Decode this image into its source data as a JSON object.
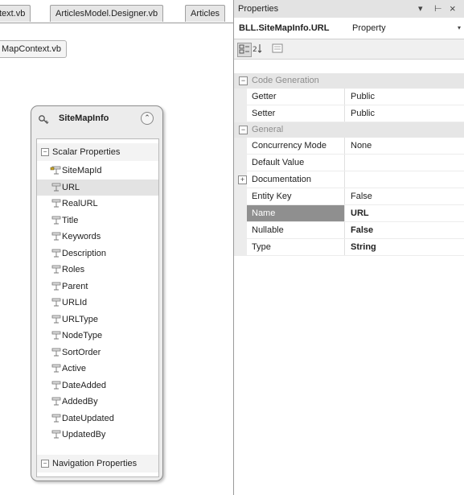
{
  "designer": {
    "tabs": [
      "text.vb",
      "ArticlesModel.Designer.vb",
      "Articles"
    ],
    "subfile_tab": "MapContext.vb",
    "entity": {
      "title": "SiteMapInfo",
      "sections": {
        "scalar": "Scalar Properties",
        "navigation": "Navigation Properties"
      },
      "properties": [
        {
          "name": "SiteMapId",
          "key": true
        },
        {
          "name": "URL",
          "selected": true
        },
        {
          "name": "RealURL"
        },
        {
          "name": "Title"
        },
        {
          "name": "Keywords"
        },
        {
          "name": "Description"
        },
        {
          "name": "Roles"
        },
        {
          "name": "Parent"
        },
        {
          "name": "URLId"
        },
        {
          "name": "URLType"
        },
        {
          "name": "NodeType"
        },
        {
          "name": "SortOrder"
        },
        {
          "name": "Active"
        },
        {
          "name": "DateAdded"
        },
        {
          "name": "AddedBy"
        },
        {
          "name": "DateUpdated"
        },
        {
          "name": "UpdatedBy"
        }
      ]
    }
  },
  "properties_pane": {
    "title": "Properties",
    "window_buttons": {
      "pin": "- ⊕",
      "close": "×"
    },
    "object_name": "BLL.SiteMapInfo.URL",
    "object_type": "Property",
    "categories": {
      "code_generation": "Code Generation",
      "general": "General"
    },
    "rows": {
      "getter": {
        "name": "Getter",
        "value": "Public"
      },
      "setter": {
        "name": "Setter",
        "value": "Public"
      },
      "concurrency_mode": {
        "name": "Concurrency Mode",
        "value": "None"
      },
      "default_value": {
        "name": "Default Value",
        "value": ""
      },
      "documentation": {
        "name": "Documentation",
        "value": ""
      },
      "entity_key": {
        "name": "Entity Key",
        "value": "False"
      },
      "name": {
        "name": "Name",
        "value": "URL"
      },
      "nullable": {
        "name": "Nullable",
        "value": "False"
      },
      "type": {
        "name": "Type",
        "value": "String"
      }
    }
  }
}
